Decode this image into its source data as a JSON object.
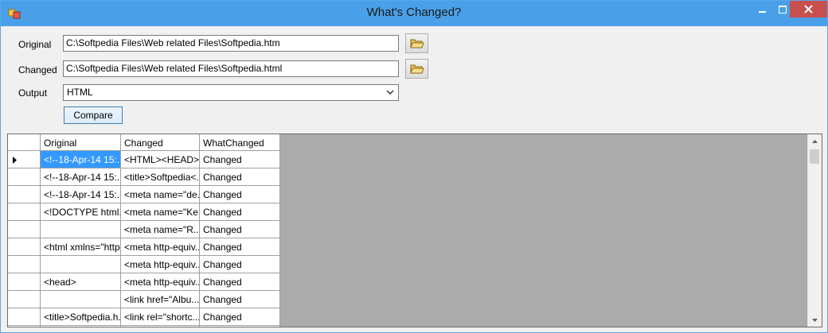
{
  "window": {
    "title": "What's Changed?"
  },
  "form": {
    "original_label": "Original",
    "original_value": "C:\\Softpedia Files\\Web related Files\\Softpedia.htm",
    "changed_label": "Changed",
    "changed_value": "C:\\Softpedia Files\\Web related Files\\Softpedia.html",
    "output_label": "Output",
    "output_value": "HTML",
    "compare_label": "Compare"
  },
  "grid": {
    "columns": [
      "Original",
      "Changed",
      "WhatChanged"
    ],
    "rows": [
      [
        "<!--18-Apr-14 15:...",
        "<HTML><HEAD>",
        "Changed"
      ],
      [
        "<!--18-Apr-14 15:...",
        "<title>Softpedia<...",
        "Changed"
      ],
      [
        "<!--18-Apr-14 15:...",
        "<meta name=\"de...",
        "Changed"
      ],
      [
        "<!DOCTYPE html...",
        "<meta name=\"Ke...",
        "Changed"
      ],
      [
        "",
        "<meta name=\"R...",
        "Changed"
      ],
      [
        "<html xmlns=\"http...",
        "<meta http-equiv...",
        "Changed"
      ],
      [
        "",
        "<meta http-equiv...",
        "Changed"
      ],
      [
        "<head>",
        "<meta http-equiv...",
        "Changed"
      ],
      [
        "",
        "<link href=\"Albu...",
        "Changed"
      ],
      [
        "<title>Softpedia.h...",
        "<link rel=\"shortc...",
        "Changed"
      ],
      [
        "",
        "",
        ""
      ]
    ]
  },
  "colors": {
    "titlebar": "#4aa0e8",
    "close": "#c7504f",
    "selection": "#3399ff"
  }
}
